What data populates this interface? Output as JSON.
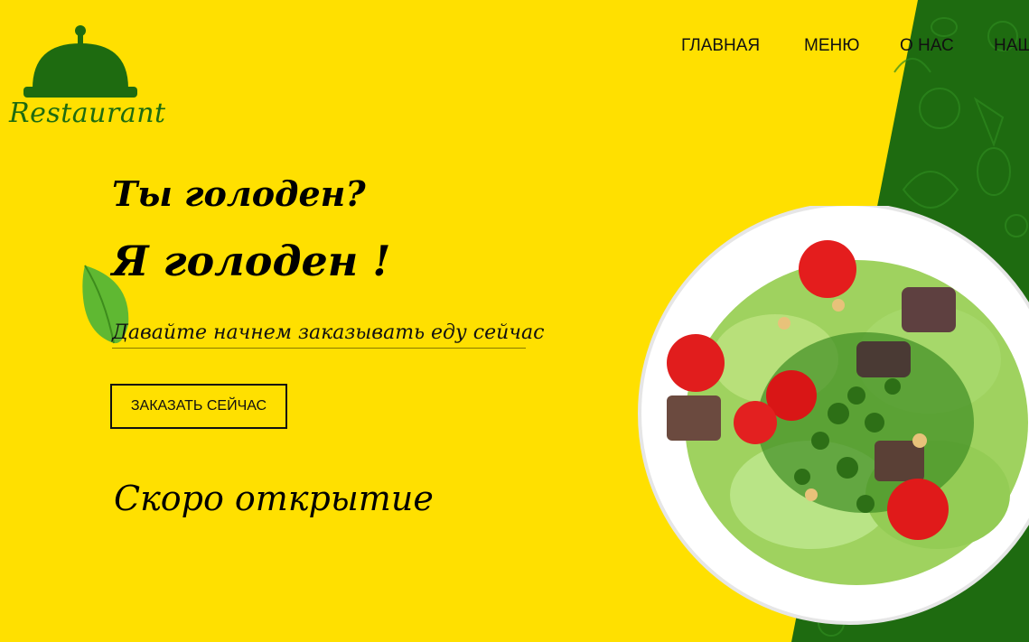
{
  "brand": {
    "logo_text": "Restaurant"
  },
  "nav": {
    "items": [
      "ГЛАВНАЯ",
      "МЕНЮ",
      "О НАС",
      "НАШ"
    ]
  },
  "hero": {
    "heading1": "Ты голоден?",
    "heading2": "Я голоден !",
    "tagline": "Давайте начнем заказывать еду сейчас",
    "order_button": "ЗАКАЗАТЬ СЕЙЧАС",
    "coming_soon": "Скоро открытие"
  },
  "colors": {
    "background": "#FFE000",
    "brand_green": "#1E6B10",
    "text": "#000000"
  },
  "icons": [
    "cloche-icon",
    "leaf-icon",
    "food-pattern"
  ]
}
